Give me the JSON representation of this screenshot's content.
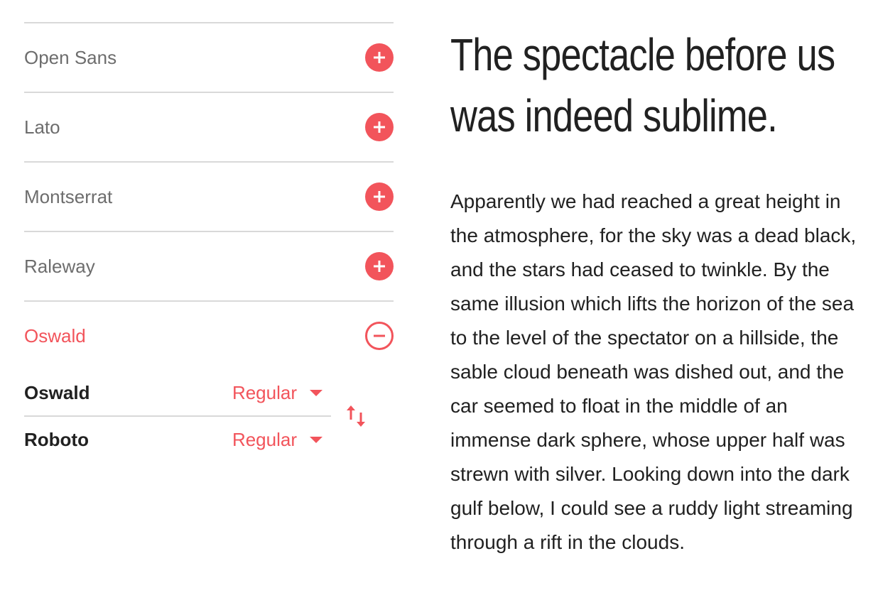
{
  "font_list": [
    {
      "name": "Open Sans",
      "action": "add"
    },
    {
      "name": "Lato",
      "action": "add"
    },
    {
      "name": "Montserrat",
      "action": "add"
    },
    {
      "name": "Raleway",
      "action": "add"
    },
    {
      "name": "Oswald",
      "action": "remove"
    }
  ],
  "pairing": {
    "heading": {
      "font": "Oswald",
      "weight": "Regular"
    },
    "body": {
      "font": "Roboto",
      "weight": "Regular"
    }
  },
  "preview": {
    "headline": "The spectacle before us was indeed sublime.",
    "paragraph": "Apparently we had reached a great height in the atmosphere, for the sky was a dead black, and the stars had ceased to twinkle. By the same illusion which lifts the horizon of the sea to the level of the spectator on a hillside, the sable cloud beneath was dished out, and the car seemed to float in the middle of an immense dark sphere, whose upper half was strewn with silver. Looking down into the dark gulf below, I could see a ruddy light streaming through a rift in the clouds."
  },
  "colors": {
    "accent": "#f2545b",
    "divider": "#d9d9d9",
    "muted_text": "#6d6d6d",
    "text": "#212121"
  },
  "icons": {
    "add": "plus-circle-icon",
    "remove": "minus-circle-icon",
    "swap": "swap-vertical-icon",
    "dropdown": "caret-down-icon"
  }
}
